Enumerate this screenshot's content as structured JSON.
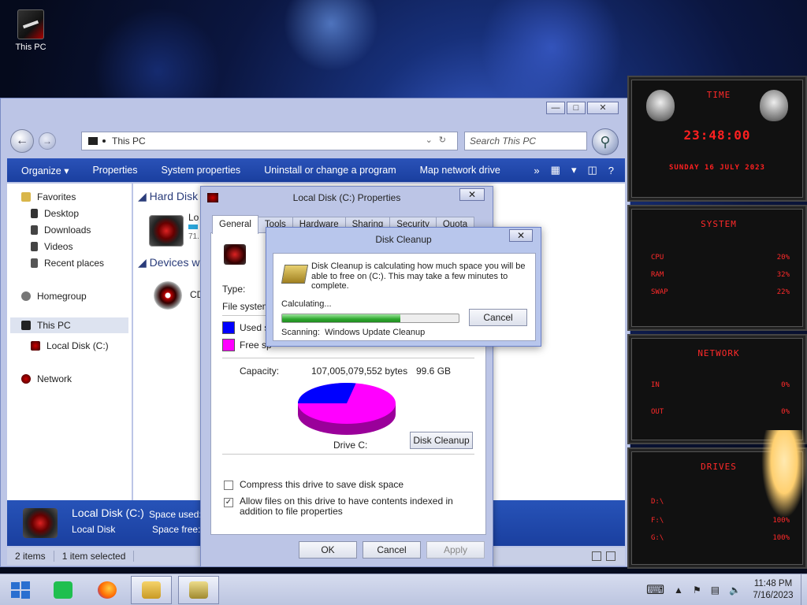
{
  "desktop": {
    "icon_label": "This PC"
  },
  "explorer": {
    "address": "This PC",
    "search_placeholder": "Search This PC",
    "commands": [
      "Organize ▾",
      "Properties",
      "System properties",
      "Uninstall or change a program",
      "Map network drive"
    ],
    "tree": {
      "favorites": "Favorites",
      "desktop": "Desktop",
      "downloads": "Downloads",
      "videos": "Videos",
      "recent": "Recent places",
      "homegroup": "Homegroup",
      "this_pc": "This PC",
      "local_disk": "Local Disk (C:)",
      "network": "Network"
    },
    "sections": {
      "hard_disk": "Hard Disk",
      "devices": "Devices w"
    },
    "items": {
      "local_trunc": "Lo",
      "local_size_trunc": "71.",
      "cd_trunc": "CD"
    },
    "details": {
      "name": "Local Disk (C:)",
      "type": "Local Disk",
      "space_used_label": "Space used:",
      "space_free_label": "Space free:"
    },
    "status": {
      "items": "2 items",
      "selected": "1 item selected"
    }
  },
  "properties": {
    "title": "Local Disk (C:) Properties",
    "tabs": [
      "General",
      "Tools",
      "Hardware",
      "Sharing",
      "Security",
      "Quota"
    ],
    "type_label": "Type:",
    "fs_label": "File system:",
    "used_label": "Used sp",
    "free_label": "Free sp",
    "capacity_label": "Capacity:",
    "capacity_bytes": "107,005,079,552 bytes",
    "capacity_gb": "99.6 GB",
    "drive_label": "Drive C:",
    "disk_cleanup_btn": "Disk Cleanup",
    "compress_label": "Compress this drive to save disk space",
    "index_label": "Allow files on this drive to have contents indexed in addition to file properties",
    "ok": "OK",
    "cancel": "Cancel",
    "apply": "Apply",
    "used_color": "#0000ff",
    "free_color": "#ff00ff",
    "used_fraction": 0.28
  },
  "cleanup": {
    "title": "Disk Cleanup",
    "message": "Disk Cleanup is calculating how much space you will be able to free on  (C:). This may take a few minutes to complete.",
    "calculating": "Calculating...",
    "cancel": "Cancel",
    "scanning_label": "Scanning:",
    "scanning_item": "Windows Update Cleanup",
    "progress": 0.67
  },
  "gadgets": {
    "time": {
      "header": "TIME",
      "clock": "23:48:00",
      "date": "SUNDAY 16 JULY 2023"
    },
    "system": {
      "header": "SYSTEM",
      "rows": [
        {
          "label": "CPU",
          "value": "20%"
        },
        {
          "label": "RAM",
          "value": "32%"
        },
        {
          "label": "SWAP",
          "value": "22%"
        }
      ]
    },
    "network": {
      "header": "NETWORK",
      "rows": [
        {
          "label": "IN",
          "value": "0%"
        },
        {
          "label": "OUT",
          "value": "0%"
        }
      ]
    },
    "drives": {
      "header": "DRIVES",
      "rows": [
        {
          "label": "D:\\",
          "value": ""
        },
        {
          "label": "F:\\",
          "value": "100%"
        },
        {
          "label": "G:\\",
          "value": "100%"
        }
      ]
    }
  },
  "taskbar": {
    "time": "11:48 PM",
    "date": "7/16/2023"
  },
  "icons": [
    "windows-start-icon",
    "spotify-icon",
    "firefox-icon",
    "file-explorer-icon",
    "disk-cleanup-icon",
    "keyboard-icon",
    "flag-icon",
    "network-icon",
    "volume-icon"
  ]
}
